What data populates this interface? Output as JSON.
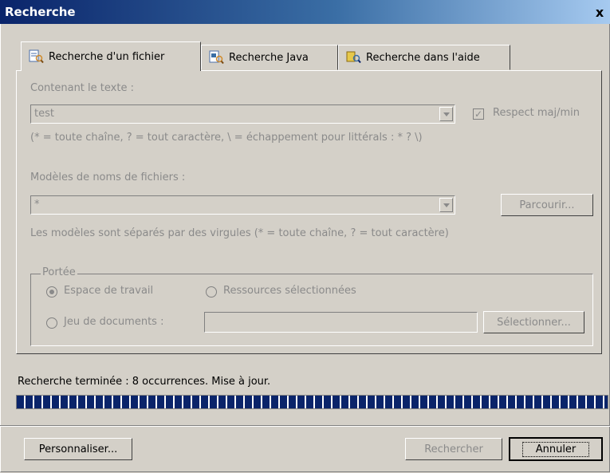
{
  "window": {
    "title": "Recherche",
    "close_label": "x"
  },
  "tabs": [
    {
      "label": "Recherche d'un fichier",
      "active": true,
      "icon": "file-search-icon"
    },
    {
      "label": "Recherche Java",
      "active": false,
      "icon": "java-search-icon"
    },
    {
      "label": "Recherche dans l'aide",
      "active": false,
      "icon": "help-search-icon"
    }
  ],
  "form": {
    "text_label": "Contenant le texte :",
    "text_value": "test",
    "case_label": "Respect maj/min",
    "case_checked": true,
    "text_hint": "(* = toute chaîne, ? = tout caractère, \\ = échappement pour littérals : * ? \\)",
    "pattern_label": "Modèles de noms de fichiers :",
    "pattern_value": "*",
    "browse_label": "Parcourir...",
    "pattern_hint": "Les modèles sont séparés par des virgules (* = toute chaîne, ? = tout caractère)"
  },
  "scope": {
    "legend": "Portée",
    "workspace_label": "Espace de travail",
    "selected_resources_label": "Ressources sélectionnées",
    "working_set_label": "Jeu de documents :",
    "working_set_value": "",
    "select_label": "Sélectionner...",
    "selected": "workspace"
  },
  "status": {
    "text": "Recherche terminée : 8 occurrences. Mise à jour.",
    "progress": 1.0
  },
  "footer": {
    "customize_label": "Personnaliser...",
    "search_label": "Rechercher",
    "cancel_label": "Annuler"
  },
  "colors": {
    "title_start": "#0a246a",
    "title_end": "#a6caf0",
    "dialog_bg": "#d4d0c8",
    "progress": "#0a246a"
  }
}
